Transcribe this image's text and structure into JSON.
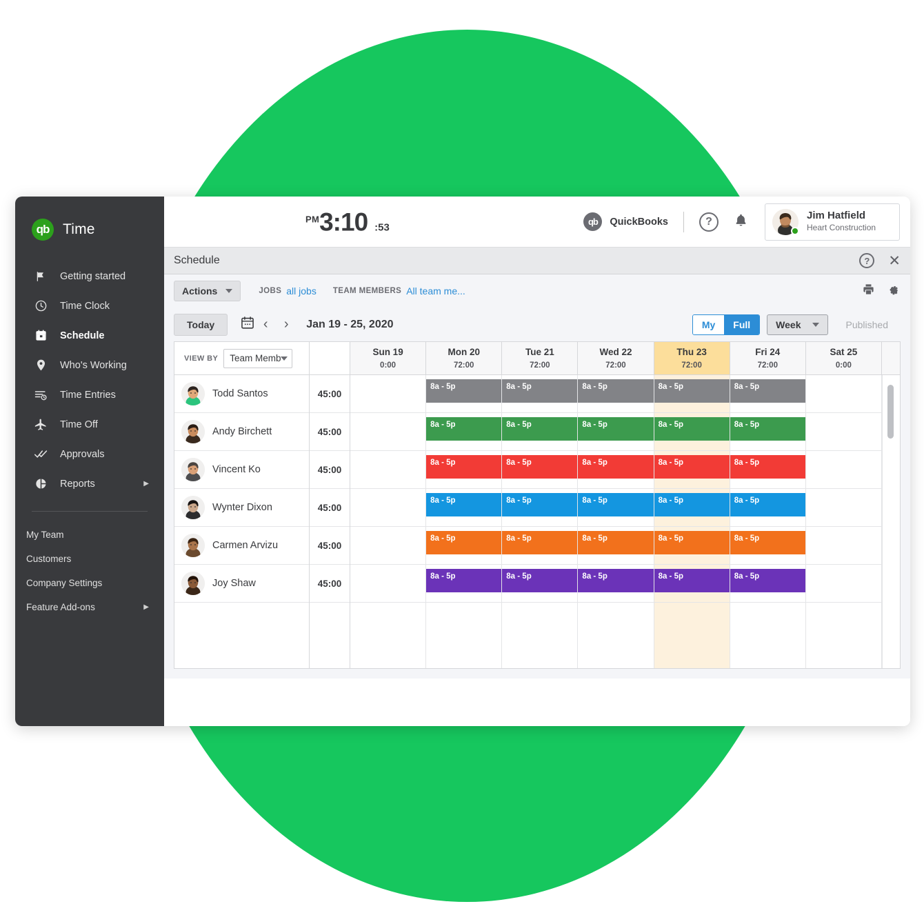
{
  "brand": {
    "name": "Time",
    "logo_text": "qb"
  },
  "sidebar": {
    "items": [
      {
        "label": "Getting started",
        "icon": "flag-icon",
        "active": false
      },
      {
        "label": "Time Clock",
        "icon": "clock-icon",
        "active": false
      },
      {
        "label": "Schedule",
        "icon": "calendar-icon",
        "active": true
      },
      {
        "label": "Who's Working",
        "icon": "location-pin-icon",
        "active": false
      },
      {
        "label": "Time Entries",
        "icon": "list-clock-icon",
        "active": false
      },
      {
        "label": "Time Off",
        "icon": "airplane-icon",
        "active": false
      },
      {
        "label": "Approvals",
        "icon": "double-check-icon",
        "active": false,
        "caret": "▶"
      }
    ],
    "sub_items": [
      {
        "label": "My Team"
      },
      {
        "label": "Customers"
      },
      {
        "label": "Company Settings"
      },
      {
        "label": "Feature Add-ons",
        "caret": "▶"
      }
    ]
  },
  "topbar": {
    "clock": {
      "ampm": "PM",
      "time": "3:10",
      "seconds": ":53"
    },
    "quickbooks_label": "QuickBooks",
    "quickbooks_mark": "qb",
    "help_icon_glyph": "?",
    "user": {
      "name": "Jim Hatfield",
      "org": "Heart Construction"
    }
  },
  "panel": {
    "title": "Schedule",
    "help_glyph": "?",
    "close_glyph": "✕"
  },
  "toolbar": {
    "actions_label": "Actions",
    "jobs_label": "JOBS",
    "jobs_value": "all jobs",
    "team_members_label": "TEAM MEMBERS",
    "team_members_value": "All team me..."
  },
  "datenav": {
    "today_label": "Today",
    "range": "Jan 19 - 25, 2020",
    "prev_glyph": "‹",
    "next_glyph": "›",
    "view_my": "My",
    "view_full": "Full",
    "period": "Week",
    "published_label": "Published"
  },
  "grid": {
    "view_by_label": "VIEW BY",
    "view_by_value": "Team Membe",
    "days": [
      {
        "name": "Sun 19",
        "hours": "0:00",
        "today": false
      },
      {
        "name": "Mon 20",
        "hours": "72:00",
        "today": false
      },
      {
        "name": "Tue 21",
        "hours": "72:00",
        "today": false
      },
      {
        "name": "Wed 22",
        "hours": "72:00",
        "today": false
      },
      {
        "name": "Thu 23",
        "hours": "72:00",
        "today": true
      },
      {
        "name": "Fri 24",
        "hours": "72:00",
        "today": false
      },
      {
        "name": "Sat 25",
        "hours": "0:00",
        "today": false
      }
    ],
    "rows": [
      {
        "name": "Todd Santos",
        "hours": "45:00",
        "color": "#828387",
        "skin": "#E0A879",
        "hair": "#2D2420",
        "shirt": "#2BC47D"
      },
      {
        "name": "Andy Birchett",
        "hours": "45:00",
        "color": "#3C9B4E",
        "skin": "#C98C5E",
        "hair": "#2A1C14",
        "shirt": "#3A2A1E"
      },
      {
        "name": "Vincent Ko",
        "hours": "45:00",
        "color": "#F23B36",
        "skin": "#D9A077",
        "hair": "#4A4440",
        "shirt": "#4D4D4F"
      },
      {
        "name": "Wynter Dixon",
        "hours": "45:00",
        "color": "#1496E0",
        "skin": "#C9A68A",
        "hair": "#171312",
        "shirt": "#2C2C2E"
      },
      {
        "name": "Carmen Arvizu",
        "hours": "45:00",
        "color": "#F2711C",
        "skin": "#A9744B",
        "hair": "#3A2312",
        "shirt": "#6B4A2E"
      },
      {
        "name": "Joy Shaw",
        "hours": "45:00",
        "color": "#6B33B8",
        "skin": "#8A5A38",
        "hair": "#221208",
        "shirt": "#3B2718"
      }
    ],
    "event_label": "8a - 5p",
    "event_days": [
      1,
      2,
      3,
      4,
      5
    ]
  },
  "colors": {
    "brand_green": "#16C75E",
    "qb_green": "#2CA01C",
    "sidebar_bg": "#393A3D",
    "accent_blue": "#2C8DD6",
    "today_header": "#FCDE9B",
    "today_column": "#FDF1DD"
  }
}
